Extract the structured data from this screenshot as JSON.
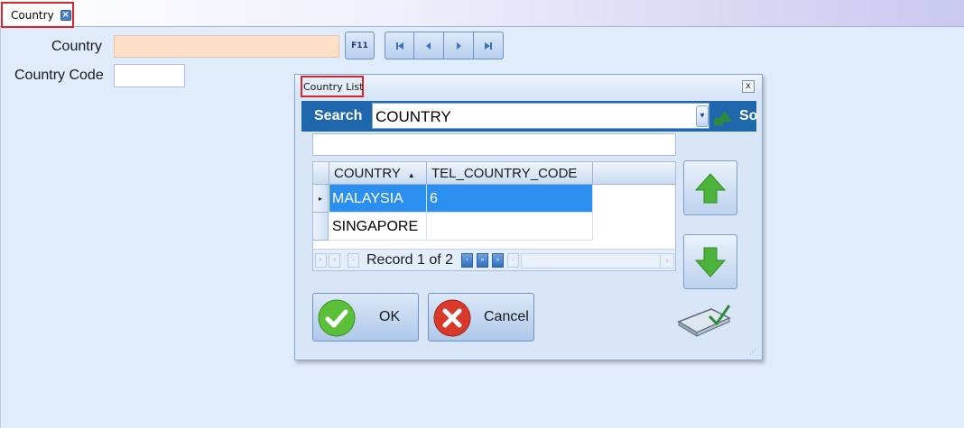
{
  "tab": {
    "label": "Country"
  },
  "form": {
    "country_label": "Country",
    "country_value": "",
    "country_code_label": "Country Code",
    "country_code_value": "",
    "f11_label": "F11"
  },
  "dialog": {
    "title": "Country List",
    "close_glyph": "x",
    "search_label": "Search",
    "search_field": "COUNTRY",
    "search_button_label": "So",
    "filter_value": "",
    "columns": [
      "COUNTRY",
      "TEL_COUNTRY_CODE"
    ],
    "sort_indicator": "▲",
    "rows": [
      {
        "country": "MALAYSIA",
        "tel_country_code": "6",
        "selected": true
      },
      {
        "country": "SINGAPORE",
        "tel_country_code": "",
        "selected": false
      }
    ],
    "record_text": "Record 1 of 2",
    "ok_label": "OK",
    "cancel_label": "Cancel"
  },
  "colors": {
    "accent": "#1f67ad",
    "selection": "#2b8ff0",
    "highlight_outline": "#d9262c",
    "country_input_bg": "#fde0c7"
  },
  "icons": [
    "close-icon",
    "first-record-icon",
    "previous-record-icon",
    "next-record-icon",
    "last-record-icon",
    "arrow-up-icon",
    "arrow-down-icon",
    "check-icon",
    "cancel-x-icon",
    "keyboard-icon"
  ]
}
